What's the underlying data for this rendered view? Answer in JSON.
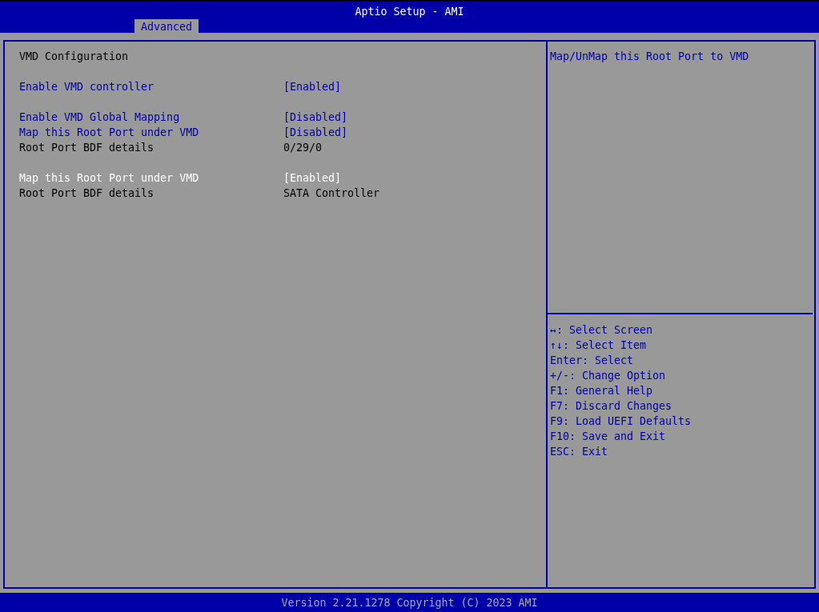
{
  "window": {
    "title": "Aptio Setup - AMI"
  },
  "tabs": [
    {
      "label": "Advanced",
      "selected": true
    }
  ],
  "sections": [
    {
      "rows": [
        {
          "kind": "heading",
          "label": "VMD Configuration"
        }
      ]
    },
    {
      "rows": [
        {
          "kind": "option",
          "label": "Enable VMD controller",
          "value": "[Enabled]",
          "selected": false
        }
      ]
    },
    {
      "rows": [
        {
          "kind": "option",
          "label": "Enable VMD Global Mapping",
          "value": "[Disabled]",
          "selected": false
        },
        {
          "kind": "option",
          "label": "Map this Root Port under VMD",
          "value": "[Disabled]",
          "selected": false
        },
        {
          "kind": "info",
          "label": "Root Port BDF details",
          "value": "0/29/0"
        }
      ]
    },
    {
      "rows": [
        {
          "kind": "option",
          "label": "Map this Root Port under VMD",
          "value": "[Enabled]",
          "selected": true
        },
        {
          "kind": "info",
          "label": "Root Port BDF details",
          "value": "SATA Controller"
        }
      ]
    }
  ],
  "help": {
    "text": "Map/UnMap this Root Port to VMD"
  },
  "keys": [
    "↔: Select Screen",
    "↑↓: Select Item",
    "Enter: Select",
    "+/-: Change Option",
    "F1: General Help",
    "F7: Discard Changes",
    "F9: Load UEFI Defaults",
    "F10: Save and Exit",
    "ESC: Exit"
  ],
  "footer": "Version 2.21.1278 Copyright (C) 2023 AMI"
}
